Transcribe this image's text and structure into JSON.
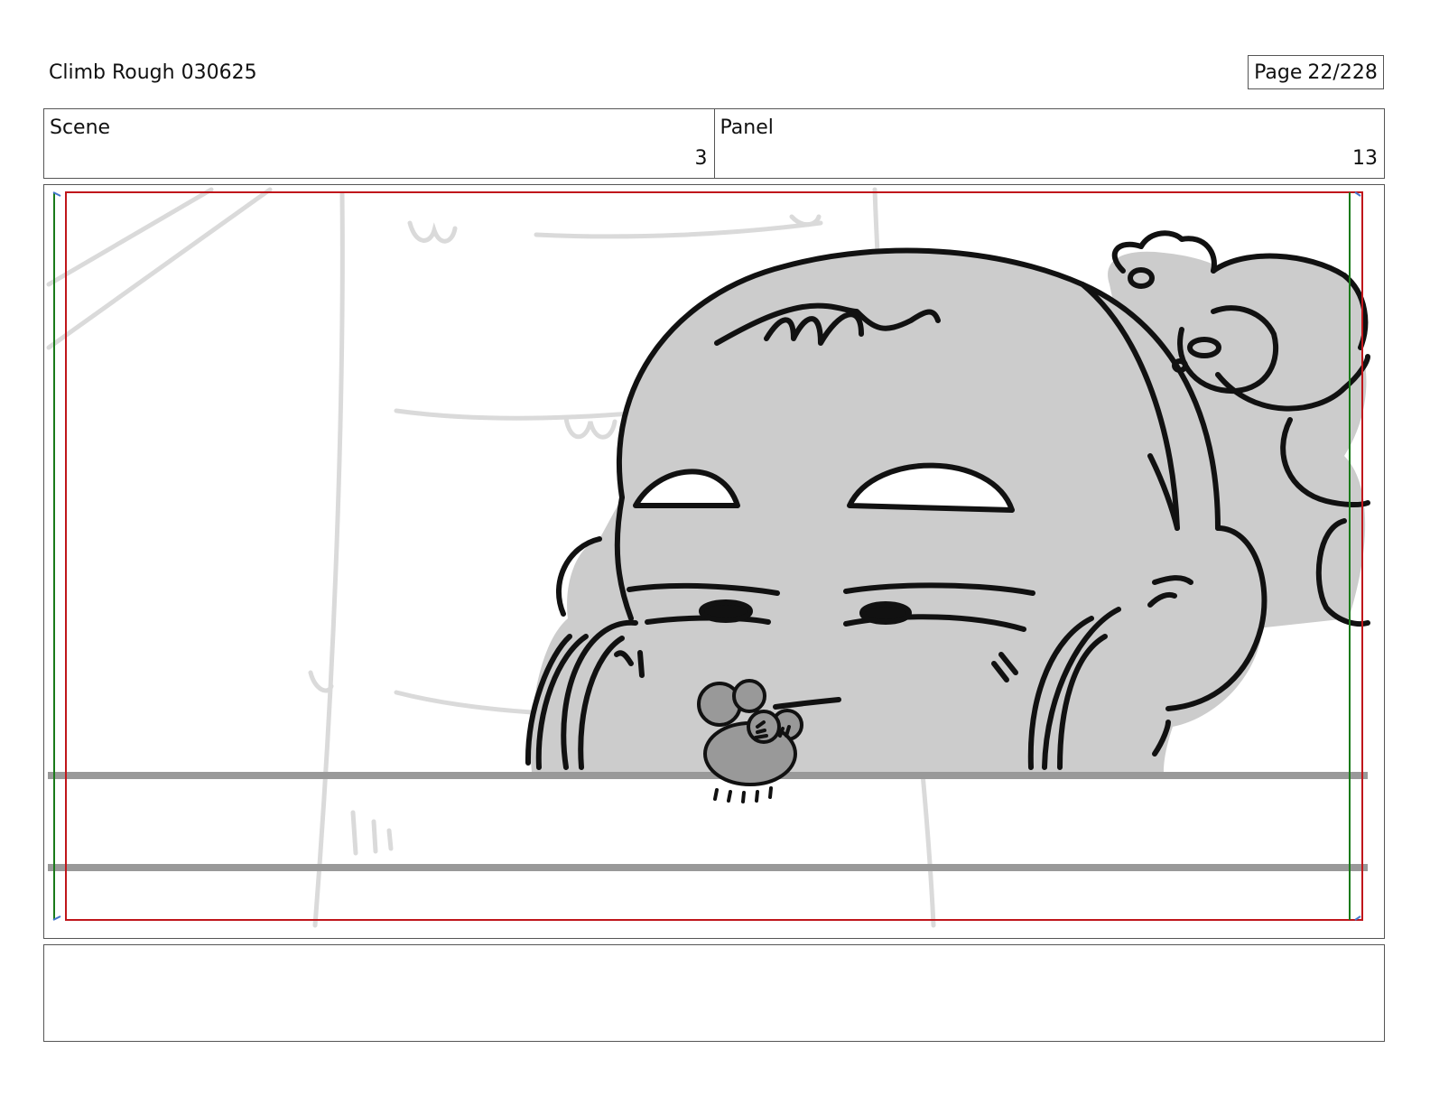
{
  "document": {
    "title": "Climb Rough 030625"
  },
  "page": {
    "label": "Page",
    "number": "22/228"
  },
  "scene": {
    "label": "Scene",
    "value": "3"
  },
  "panel": {
    "label": "Panel",
    "value": "13"
  },
  "colors": {
    "safe_area_outer": "#c0161b",
    "safe_area_inner": "#1a7a1a",
    "rough_layer": "#d8d8d8",
    "fill_gray": "#cccccc",
    "ink": "#111111",
    "ledge": "#999999"
  },
  "artwork": {
    "subject": "rough storyboard sketch of a round-faced character peeking over a ledge with a small creature on its mouth"
  },
  "notes": {
    "text": ""
  }
}
